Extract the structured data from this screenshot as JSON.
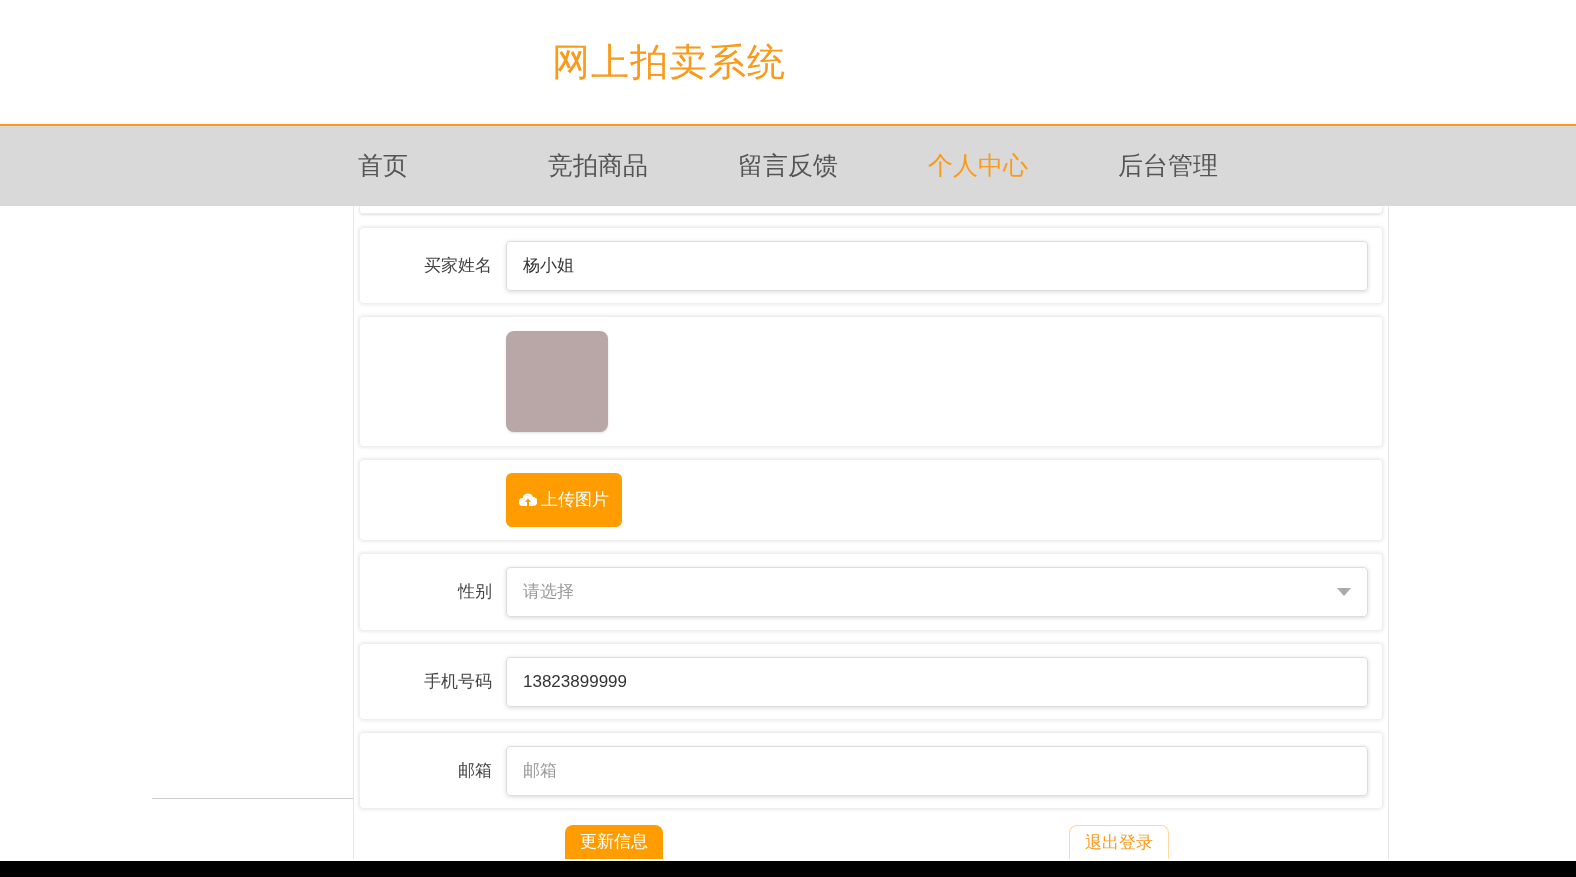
{
  "site_title": "网上拍卖系统",
  "nav": [
    {
      "label": "首页",
      "selected": false
    },
    {
      "label": "竞拍商品",
      "selected": false
    },
    {
      "label": "留言反馈",
      "selected": false
    },
    {
      "label": "个人中心",
      "selected": true
    },
    {
      "label": "后台管理",
      "selected": false
    }
  ],
  "form": [
    {
      "kind": "text",
      "label": "买家姓名",
      "value": "杨小姐"
    },
    {
      "kind": "image"
    },
    {
      "kind": "upload",
      "button": "上传图片"
    },
    {
      "kind": "select",
      "label": "性别",
      "placeholder": "请选择"
    },
    {
      "kind": "text",
      "label": "手机号码",
      "value": "13823899999"
    },
    {
      "kind": "text",
      "label": "邮箱",
      "placeholder": "邮箱"
    }
  ],
  "actions": [
    {
      "kind": "primary",
      "label": "更新信息"
    },
    {
      "kind": "outline",
      "label": "退出登录"
    }
  ]
}
